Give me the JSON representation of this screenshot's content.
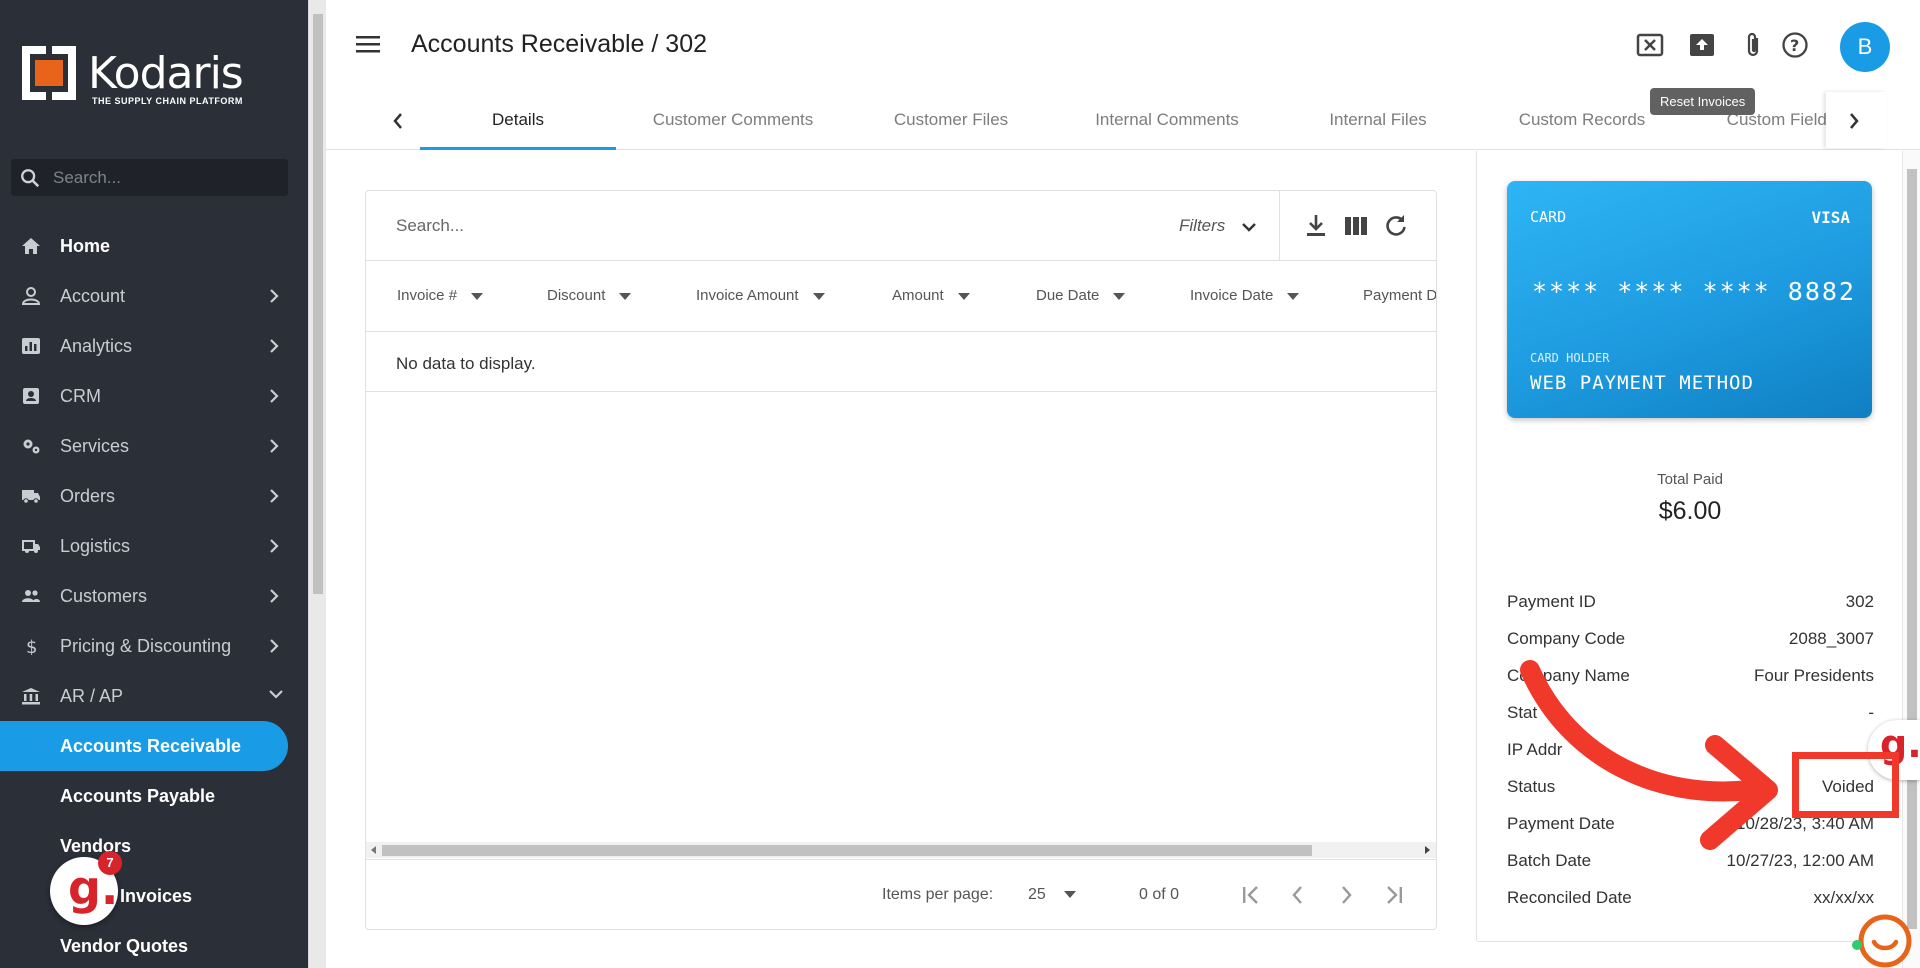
{
  "brand": {
    "name": "Kodaris",
    "tagline": "THE SUPPLY CHAIN PLATFORM",
    "accent": "#1a9be6",
    "logo_orange": "#e8641b"
  },
  "sidebar": {
    "search_placeholder": "Search...",
    "items": [
      {
        "label": "Home",
        "icon": "home-icon"
      },
      {
        "label": "Account",
        "icon": "person-icon"
      },
      {
        "label": "Analytics",
        "icon": "analytics-icon"
      },
      {
        "label": "CRM",
        "icon": "crm-icon"
      },
      {
        "label": "Services",
        "icon": "gears-icon"
      },
      {
        "label": "Orders",
        "icon": "truck-icon"
      },
      {
        "label": "Logistics",
        "icon": "logistics-icon"
      },
      {
        "label": "Customers",
        "icon": "group-icon"
      },
      {
        "label": "Pricing & Discounting",
        "icon": "dollar-icon"
      },
      {
        "label": "AR / AP",
        "icon": "bank-icon"
      }
    ],
    "subitems": [
      "Accounts Receivable",
      "Accounts Payable",
      "Vendors",
      "Invoices",
      "Vendor Quotes"
    ],
    "notification_count": "7"
  },
  "header": {
    "title": "Accounts Receivable / 302",
    "tooltip": "Reset Invoices",
    "avatar_letter": "B"
  },
  "tabs": [
    "Details",
    "Customer Comments",
    "Customer Files",
    "Internal Comments",
    "Internal Files",
    "Custom Records",
    "Custom Fields"
  ],
  "grid": {
    "search_placeholder": "Search...",
    "filters_label": "Filters",
    "columns": [
      "Invoice #",
      "Discount",
      "Invoice Amount",
      "Amount",
      "Due Date",
      "Invoice Date",
      "Payment D"
    ],
    "empty_text": "No data to display.",
    "items_per_page_label": "Items per page:",
    "items_per_page": "25",
    "range": "0 of 0"
  },
  "payment": {
    "card_type": "CARD",
    "card_brand": "VISA",
    "card_number": "**** **** **** 8882",
    "card_holder_label": "CARD HOLDER",
    "card_holder": "WEB PAYMENT METHOD",
    "total_paid_label": "Total Paid",
    "total_paid": "$6.00",
    "fields": [
      {
        "label": "Payment ID",
        "value": "302"
      },
      {
        "label": "Company Code",
        "value": "2088_3007"
      },
      {
        "label": "Company Name",
        "value": "Four Presidents"
      },
      {
        "label": "Stat",
        "value": "-"
      },
      {
        "label": "IP Addr",
        "value": ""
      },
      {
        "label": "Status",
        "value": "Voided"
      },
      {
        "label": "Payment Date",
        "value": "10/28/23, 3:40 AM"
      },
      {
        "label": "Batch Date",
        "value": "10/27/23, 12:00 AM"
      },
      {
        "label": "Reconciled Date",
        "value": "xx/xx/xx"
      }
    ]
  },
  "annotation_color": "#f0382b"
}
